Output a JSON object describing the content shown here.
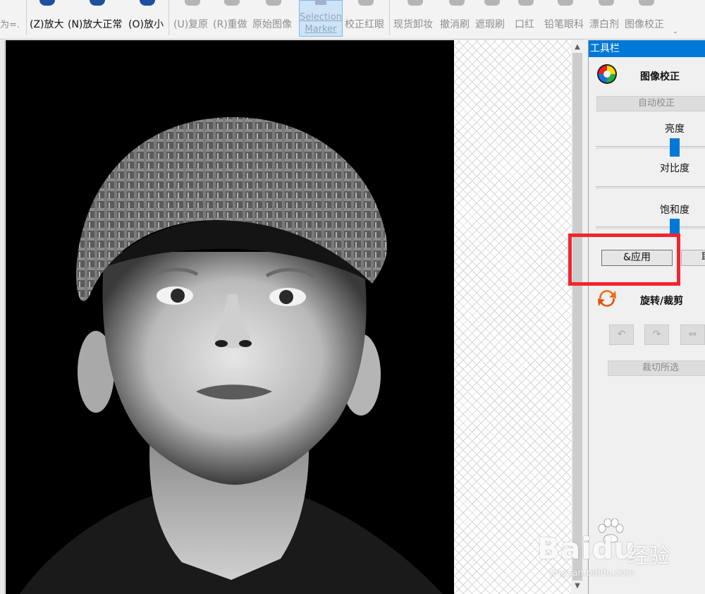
{
  "toolbar": {
    "cut_label": "为=.",
    "zoom_in": "(Z)放大",
    "zoom_normal": "(N)放大正常",
    "zoom_out": "(O)放小",
    "undo": "(U)复原",
    "redo": "(R)重做",
    "original": "原始图像",
    "selection_line1": "Selection",
    "selection_line2": "Marker",
    "redeye": "校正红眼",
    "makeup_remove": "现货卸妆",
    "erase_brush": "撤消刷",
    "blemish_brush": "遮瑕刷",
    "lipstick": "口红",
    "eyeliner": "铅笔眼科",
    "whitener": "漂白剂",
    "image_correct": "图像校正",
    "more": "⌄"
  },
  "panel": {
    "header": "工具栏",
    "section_correct_title": "图像校正",
    "auto_correct": "自动校正",
    "brightness": "亮度",
    "contrast": "对比度",
    "saturation": "饱和度",
    "apply": "&应用",
    "second_button": "取",
    "section_rotate_title": "旋转/裁剪",
    "crop_selection": "裁切所选",
    "colors": {
      "accent": "#0078d7",
      "highlight": "#f0262e"
    }
  },
  "watermark": {
    "brand": "Baidu",
    "brand_cn": "经验",
    "url": "jingyan.baidu.com"
  },
  "scrollbar": {
    "up": "▲",
    "down": "▼"
  }
}
